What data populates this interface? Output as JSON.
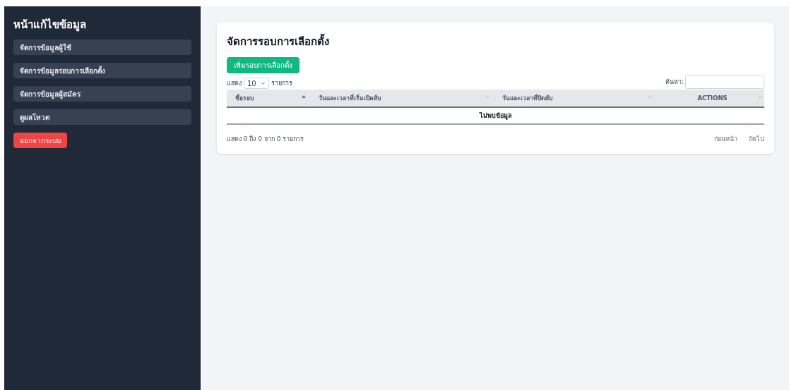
{
  "sidebar": {
    "title": "หน้าแก้ไขข้อมูล",
    "items": [
      {
        "label": "จัดการข้อมูลผู้ใช้",
        "kind": "nav"
      },
      {
        "label": "จัดการข้อมูลรอบการเลือกตั้ง",
        "kind": "nav"
      },
      {
        "label": "จัดการข้อมูลผู้สมัคร",
        "kind": "nav"
      },
      {
        "label": "ดูผลโหวต",
        "kind": "nav"
      },
      {
        "label": "ออกจากระบบ",
        "kind": "logout"
      }
    ]
  },
  "card": {
    "title": "จัดการรอบการเลือกตั้ง",
    "add_button": "เพิ่มรอบการเลือกตั้ง",
    "length": {
      "prefix": "แสดง",
      "value": "10",
      "suffix": "รายการ"
    },
    "search": {
      "label": "ค้นหา:"
    },
    "table": {
      "columns": [
        {
          "label": "ชื่อรอบ",
          "sorted": true
        },
        {
          "label": "วันและเวลาที่เริ่มเปิดผับ",
          "sorted": false
        },
        {
          "label": "วันและเวลาที่ปิดผับ",
          "sorted": false
        },
        {
          "label": "ACTIONS",
          "sorted": false
        }
      ],
      "empty": "ไม่พบข้อมูล"
    },
    "info": "แสดง 0 ถึง 0 จาก 0 รายการ",
    "pager": [
      "ก่อนหน้า",
      "ถัดไป"
    ]
  }
}
